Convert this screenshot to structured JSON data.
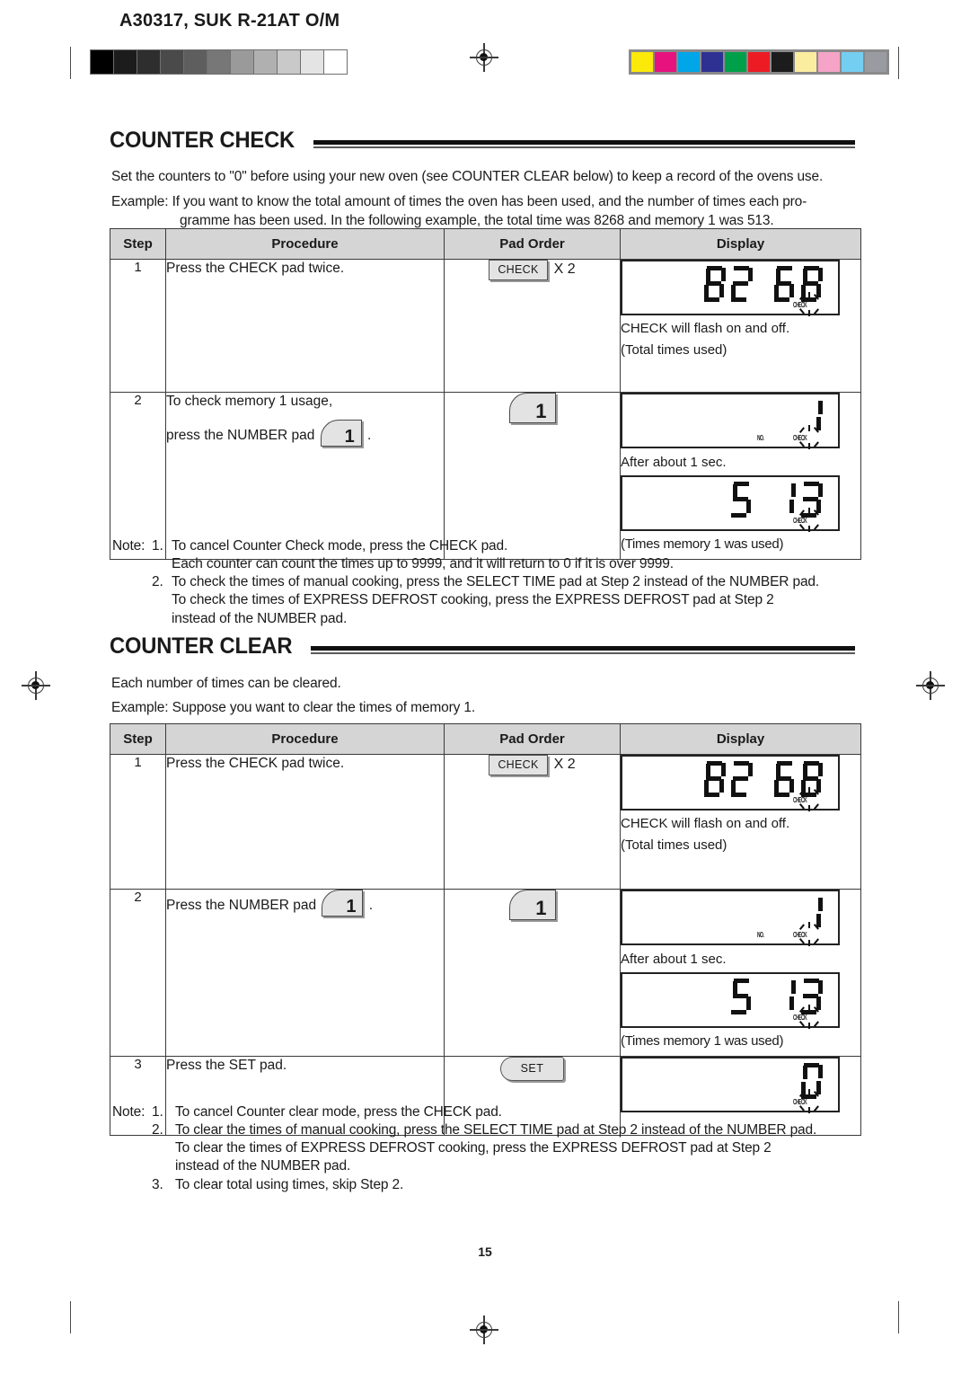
{
  "header": {
    "doc_code": "A30317, SUK R-21AT O/M",
    "grayscale_steps": [
      "#000000",
      "#1c1c1c",
      "#2e2e2e",
      "#4a4a4a",
      "#5e5e5e",
      "#777777",
      "#9a9a9a",
      "#b0b0b0",
      "#c9c9c9",
      "#e4e4e4",
      "#ffffff"
    ],
    "color_steps": [
      "#fbe90a",
      "#e8127e",
      "#00a6e8",
      "#2e3192",
      "#00a04a",
      "#ed1c24",
      "#1c1c1c",
      "#fbeda0",
      "#f5a3c7",
      "#74cef2",
      "#9a9ba0"
    ]
  },
  "sections": [
    {
      "title": "COUNTER CHECK",
      "intro": [
        "Set the counters to \"0\" before using your new oven (see COUNTER CLEAR below) to keep a record of the ovens use.",
        "Example: If you want to know the total amount of times the oven has been used, and the number of times each pro-",
        "gramme has been used. In the following example, the total time was 8268 and memory 1 was 513."
      ],
      "table": {
        "columns": [
          "Step",
          "Procedure",
          "Pad Order",
          "Display"
        ],
        "rows": [
          {
            "step": "1",
            "procedure": "Press the CHECK pad twice.",
            "pad_label": "CHECK",
            "pad_multiplier": "X 2",
            "display_value": "8268",
            "display_caption_1": "CHECK will flash on and off.",
            "display_caption_2": "(Total times used)",
            "indicator_check": "CHECK"
          },
          {
            "step": "2",
            "procedure_line_1": "To check memory 1 usage,",
            "procedure_line_2_pre": "press the NUMBER pad",
            "procedure_line_2_post": ".",
            "pad_number": "1",
            "display_value_1": "1",
            "indicator_no": "NO.",
            "indicator_check": "CHECK",
            "mid_caption": "After about 1 sec.",
            "display_value_2": "513",
            "display_caption": "(Times memory 1 was used)"
          }
        ]
      },
      "notes": {
        "label": "Note:",
        "items": [
          {
            "num": "1.",
            "lines": [
              "To cancel Counter Check mode, press the CHECK pad.",
              "Each counter can count the times up to 9999, and it will return to 0 if it is over 9999."
            ]
          },
          {
            "num": "2.",
            "lines": [
              "To check the times of manual cooking, press the SELECT TIME pad at Step 2 instead of the NUMBER pad.",
              "To check the times of EXPRESS DEFROST cooking, press the EXPRESS DEFROST pad at Step 2",
              "instead of the NUMBER pad."
            ]
          }
        ]
      }
    },
    {
      "title": "COUNTER CLEAR",
      "intro": [
        "Each number of times can be cleared.",
        "Example: Suppose you want to clear the times of memory 1."
      ],
      "table": {
        "columns": [
          "Step",
          "Procedure",
          "Pad Order",
          "Display"
        ],
        "rows": [
          {
            "step": "1",
            "procedure": "Press the CHECK pad twice.",
            "pad_label": "CHECK",
            "pad_multiplier": "X 2",
            "display_value": "8268",
            "display_caption_1": "CHECK will flash on and off.",
            "display_caption_2": "(Total times used)",
            "indicator_check": "CHECK"
          },
          {
            "step": "2",
            "procedure_pre": "Press the NUMBER pad",
            "procedure_post": ".",
            "pad_number": "1",
            "display_value_1": "1",
            "indicator_no": "NO.",
            "indicator_check": "CHECK",
            "mid_caption": "After about 1 sec.",
            "display_value_2": "513",
            "display_caption": "(Times memory 1 was used)"
          },
          {
            "step": "3",
            "procedure": "Press the SET pad.",
            "pad_label": "SET",
            "display_value": "0",
            "indicator_check": "CHECK"
          }
        ]
      },
      "notes": {
        "label": "Note:",
        "items": [
          {
            "num": "1.",
            "lines": [
              "To cancel Counter clear mode, press the CHECK pad."
            ]
          },
          {
            "num": "2.",
            "lines": [
              "To clear the times of manual cooking, press the SELECT TIME pad at Step 2 instead of the NUMBER pad.",
              "To clear the times of EXPRESS DEFROST cooking, press the EXPRESS DEFROST pad at Step 2",
              "instead of the NUMBER pad."
            ]
          },
          {
            "num": "3.",
            "lines": [
              "To clear total using times, skip Step 2."
            ]
          }
        ]
      }
    }
  ],
  "page_number": "15"
}
